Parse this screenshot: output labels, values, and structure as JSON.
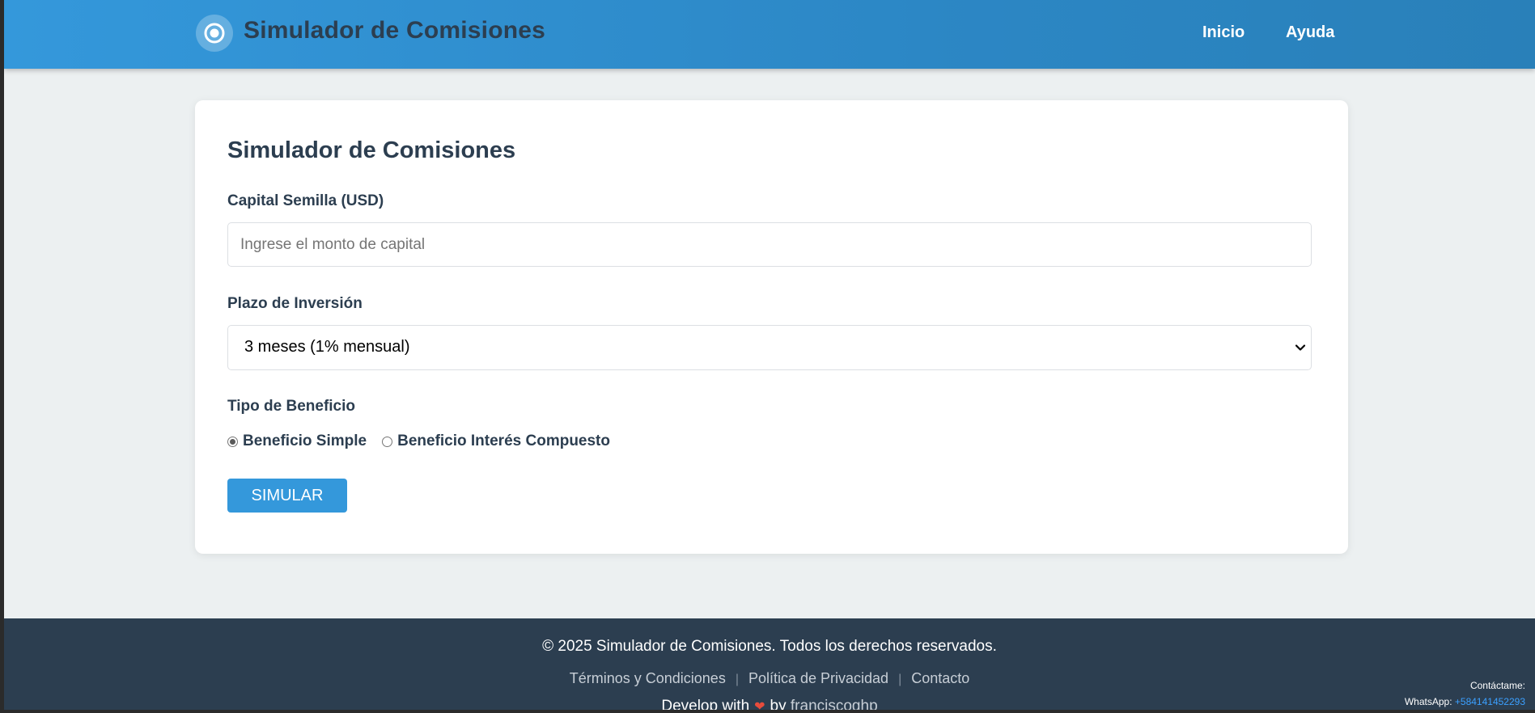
{
  "header": {
    "app_title": "Simulador de Comisiones",
    "nav": [
      {
        "label": "Inicio"
      },
      {
        "label": "Ayuda"
      }
    ]
  },
  "form": {
    "title": "Simulador de Comisiones",
    "capital": {
      "label": "Capital Semilla (USD)",
      "value": "",
      "placeholder": "Ingrese el monto de capital"
    },
    "plazo": {
      "label": "Plazo de Inversión",
      "selected": "3 meses (1% mensual)"
    },
    "tipo": {
      "label": "Tipo de Beneficio",
      "options": [
        {
          "label": "Beneficio Simple",
          "checked": true
        },
        {
          "label": "Beneficio Interés Compuesto",
          "checked": false
        }
      ]
    },
    "submit_label": "SIMULAR"
  },
  "footer": {
    "copyright": "© 2025 Simulador de Comisiones. Todos los derechos reservados.",
    "links": [
      {
        "label": "Términos y Condiciones"
      },
      {
        "label": "Política de Privacidad"
      },
      {
        "label": "Contacto"
      }
    ],
    "separator": "|",
    "develop_prefix": "Develop with",
    "develop_by": "by",
    "develop_author": "franciscoghp",
    "contact_title": "Contáctame:",
    "whatsapp_label": "WhatsApp:",
    "whatsapp_number": "+584141452293"
  },
  "colors": {
    "header_blue": "#3498db",
    "dark_navy": "#2c3e50",
    "button_blue": "#3498db",
    "page_bg": "#ecf0f1",
    "link_blue": "#3ba0ff",
    "heart_red": "#e74c3c"
  },
  "icons": {
    "logo": "target-circle-icon",
    "select": "chevron-down-icon",
    "heart": "heart-icon"
  }
}
